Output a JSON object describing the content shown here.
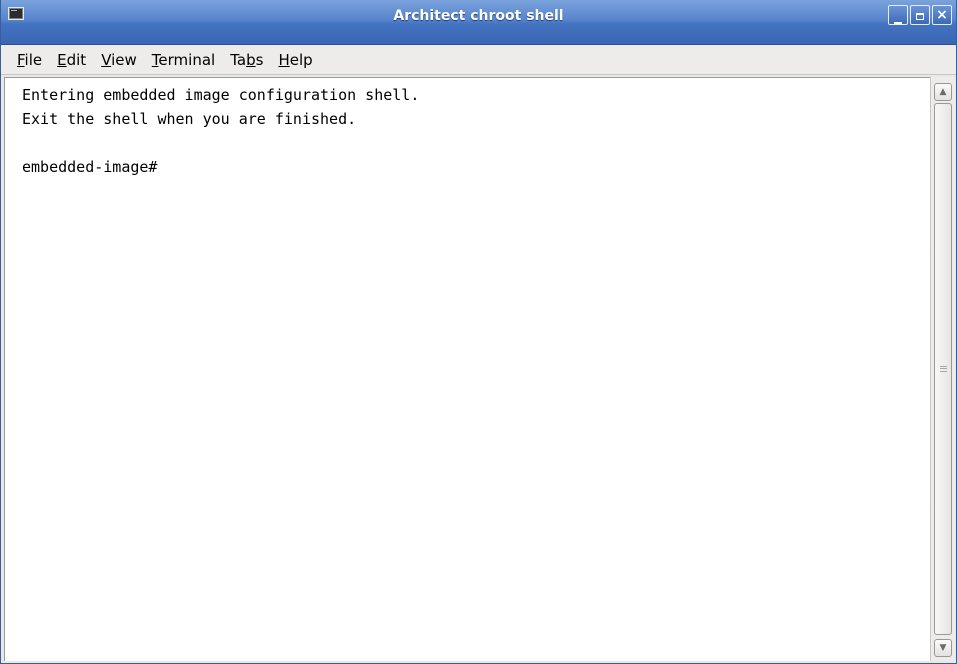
{
  "window": {
    "title": "Architect chroot shell",
    "buttons": {
      "minimize": "minimize",
      "maximize": "maximize",
      "close": "×"
    }
  },
  "menu": {
    "file": {
      "mnemonic": "F",
      "rest": "ile"
    },
    "edit": {
      "mnemonic": "E",
      "rest": "dit"
    },
    "view": {
      "mnemonic": "V",
      "rest": "iew"
    },
    "terminal": {
      "mnemonic": "T",
      "rest": "erminal"
    },
    "tabs": {
      "pre": "Ta",
      "mnemonic": "b",
      "rest": "s"
    },
    "help": {
      "mnemonic": "H",
      "rest": "elp"
    }
  },
  "terminal": {
    "lines": [
      "Entering embedded image configuration shell.",
      "Exit the shell when you are finished.",
      "",
      "embedded-image#"
    ]
  },
  "scrollbar": {
    "up_arrow": "▲",
    "down_arrow": "▼"
  }
}
